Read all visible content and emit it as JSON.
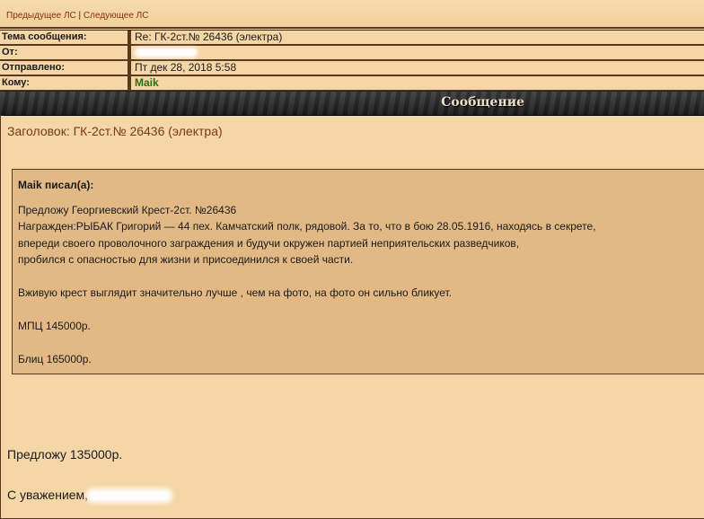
{
  "nav": {
    "prev": "Предыдущее ЛС",
    "sep": "|",
    "next": "Следующее ЛС"
  },
  "header": {
    "subject_label": "Тема сообщения:",
    "subject_value": "Re: ГК-2ст.№ 26436 (электра)",
    "from_label": "От:",
    "sent_label": "Отправлено:",
    "sent_value": "Пт дек 28, 2018 5:58",
    "to_label": "Кому:",
    "to_value": "Maik"
  },
  "bar": {
    "title": "Сообщение"
  },
  "message": {
    "subject_line": "Заголовок: ГК-2ст.№ 26436 (электра)",
    "quote": {
      "author": "Maik писал(а):",
      "lines": [
        "Предложу Георгиевский Крест-2ст. №26436",
        "Награжден:РЫБАК Григорий — 44 пех. Камчатский полк, рядовой. За то, что в бою 28.05.1916, находясь в секрете,",
        "впереди своего проволочного заграждения и будучи окружен партией неприятельских разведчиков,",
        "пробился с опасностью для жизни и присоединился к своей части.",
        "Вживую крест выглядит значительно лучше , чем на фото, на фото он сильно бликует.",
        "МПЦ 145000р.",
        "Блиц 165000р."
      ]
    },
    "offer": "Предложу 135000р.",
    "regards": "С уважением,"
  }
}
